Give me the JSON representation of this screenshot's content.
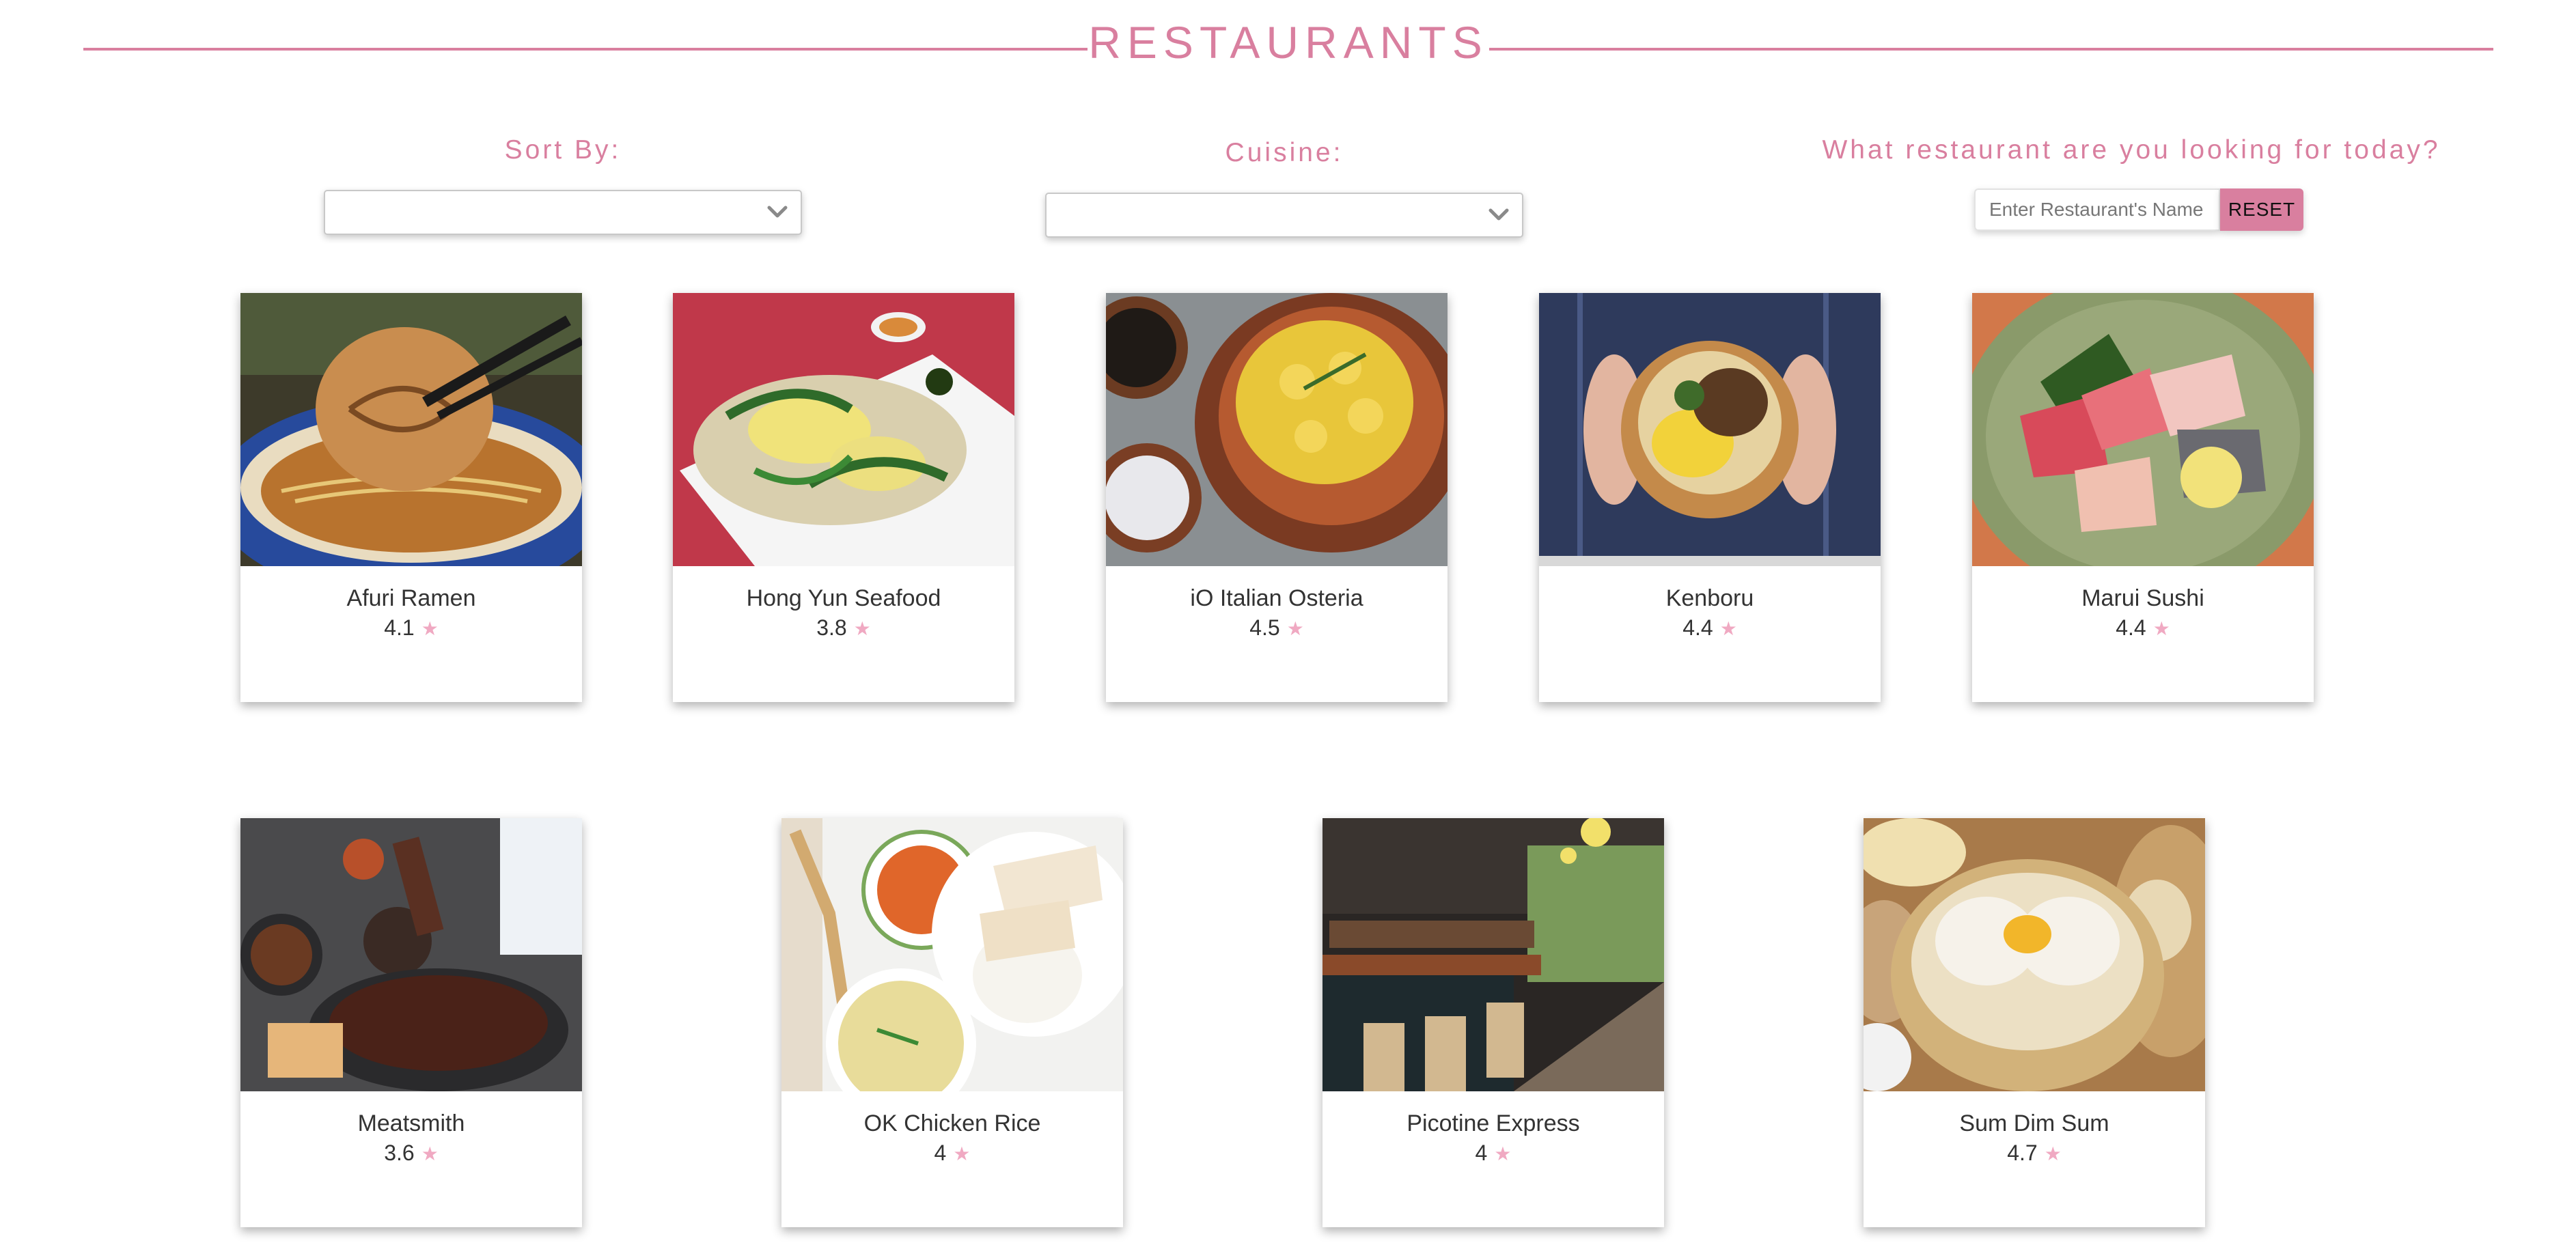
{
  "header": {
    "title": "RESTAURANTS"
  },
  "filters": {
    "sort_label": "Sort By:",
    "sort_value": "",
    "cuisine_label": "Cuisine:",
    "cuisine_value": "",
    "search_label": "What restaurant are you looking for today?",
    "search_placeholder": "Enter Restaurant's Name",
    "search_value": "",
    "reset_label": "RESET"
  },
  "colors": {
    "accent": "#d97f9f",
    "star": "#f0a9c2"
  },
  "restaurants": [
    {
      "name": "Afuri Ramen",
      "rating": "4.1",
      "image": "ramen-bowl-photo"
    },
    {
      "name": "Hong Yun Seafood",
      "rating": "3.8",
      "image": "fried-noodles-photo"
    },
    {
      "name": "iO Italian Osteria",
      "rating": "4.5",
      "image": "gnocchi-dish-photo"
    },
    {
      "name": "Kenboru",
      "rating": "4.4",
      "image": "grain-bowl-photo"
    },
    {
      "name": "Marui Sushi",
      "rating": "4.4",
      "image": "sashimi-platter-photo"
    },
    {
      "name": "Meatsmith",
      "rating": "3.6",
      "image": "bbq-platter-photo"
    },
    {
      "name": "OK Chicken Rice",
      "rating": "4",
      "image": "chicken-rice-photo"
    },
    {
      "name": "Picotine Express",
      "rating": "4",
      "image": "bar-interior-photo"
    },
    {
      "name": "Sum Dim Sum",
      "rating": "4.7",
      "image": "dim-sum-photo"
    }
  ]
}
